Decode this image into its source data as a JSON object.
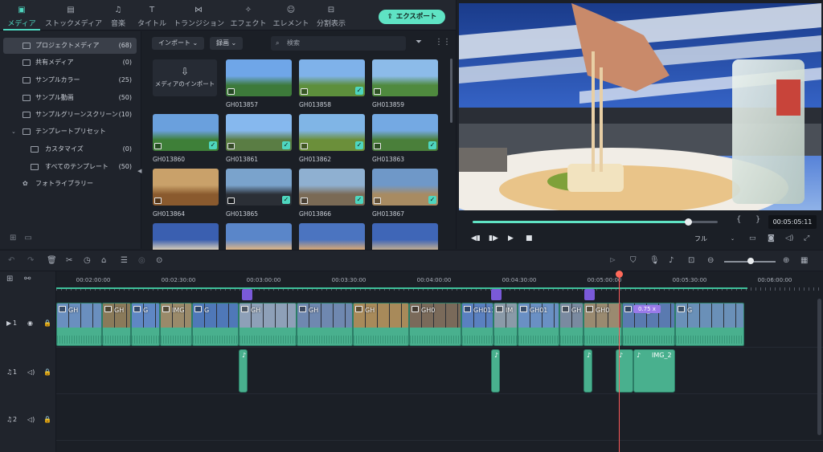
{
  "tabs": [
    {
      "label": "メディア",
      "icon": "media-icon",
      "active": true
    },
    {
      "label": "ストックメディア",
      "icon": "stock-media-icon"
    },
    {
      "label": "音楽",
      "icon": "music-icon"
    },
    {
      "label": "タイトル",
      "icon": "title-icon"
    },
    {
      "label": "トランジション",
      "icon": "transition-icon"
    },
    {
      "label": "エフェクト",
      "icon": "effect-icon"
    },
    {
      "label": "エレメント",
      "icon": "element-icon"
    },
    {
      "label": "分割表示",
      "icon": "split-screen-icon"
    }
  ],
  "export_label": "エクスポート",
  "sidebar": {
    "items": [
      {
        "label": "プロジェクトメディア",
        "count": "(68)"
      },
      {
        "label": "共有メディア",
        "count": "(0)"
      },
      {
        "label": "サンプルカラー",
        "count": "(25)"
      },
      {
        "label": "サンプル動画",
        "count": "(50)"
      },
      {
        "label": "サンプルグリーンスクリーン",
        "count": "(10)"
      },
      {
        "label": "テンプレートプリセット",
        "count": ""
      },
      {
        "label": "カスタマイズ",
        "count": "(0)"
      },
      {
        "label": "すべてのテンプレート",
        "count": "(50)"
      },
      {
        "label": "フォトライブラリー",
        "count": ""
      }
    ]
  },
  "media": {
    "import_dropdown": "インポート",
    "record_dropdown": "録画",
    "search_placeholder": "検索",
    "import_card_label": "メディアのインポート",
    "thumbs": [
      {
        "name": "GH013857",
        "checked": false
      },
      {
        "name": "GH013858",
        "checked": true
      },
      {
        "name": "GH013859",
        "checked": false
      },
      {
        "name": "GH013860",
        "checked": true
      },
      {
        "name": "GH013861",
        "checked": true
      },
      {
        "name": "GH013862",
        "checked": true
      },
      {
        "name": "GH013863",
        "checked": true
      },
      {
        "name": "GH013864",
        "checked": false
      },
      {
        "name": "GH013865",
        "checked": true
      },
      {
        "name": "GH013866",
        "checked": true
      },
      {
        "name": "GH013867",
        "checked": true
      },
      {
        "name": "",
        "checked": false
      },
      {
        "name": "",
        "checked": false
      },
      {
        "name": "",
        "checked": false
      },
      {
        "name": "",
        "checked": false
      }
    ]
  },
  "preview": {
    "timecode": "00:05:05:11",
    "quality": "フル",
    "progress": 0.88
  },
  "timeline": {
    "ruler": [
      "00:02:00:00",
      "00:02:30:00",
      "00:03:00:00",
      "00:03:30:00",
      "00:04:00:00",
      "00:04:30:00",
      "00:05:00:00",
      "00:05:30:00",
      "00:06:00:00"
    ],
    "tracks": [
      {
        "type": "video",
        "num": "1"
      },
      {
        "type": "audio",
        "num": "1"
      },
      {
        "type": "audio",
        "num": "2"
      }
    ],
    "video_clip_labels": [
      "GH",
      "GH",
      "G",
      "IMG",
      "G",
      "GH",
      "GH",
      "GH",
      "GH0",
      "GH013",
      "IM",
      "GH01",
      "GH",
      "GH0",
      "IMG_2",
      "G"
    ],
    "audio_clip_labels": [
      "IMG_2"
    ],
    "speed_tag": "0.75 x"
  },
  "colors": {
    "accent": "#4ed6bf",
    "export": "#5fe3c4",
    "playhead": "#ff5a5a",
    "marker": "#7a5ad9",
    "clip": "#49b08e"
  }
}
